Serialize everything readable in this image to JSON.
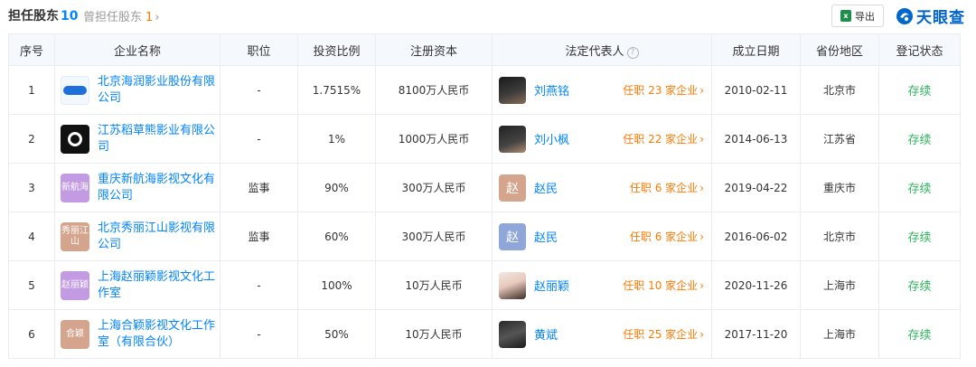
{
  "header": {
    "title": "担任股东",
    "title_count": "10",
    "sub_title": "曾担任股东",
    "sub_count": "1",
    "sub_chevron": "›",
    "export_label": "导出",
    "brand": "天眼查"
  },
  "colors": {
    "link": "#0084ff",
    "tenure": "#ff7a00",
    "status": "#2db55d",
    "header_bg": "#f5f8fc"
  },
  "table": {
    "columns": [
      "序号",
      "企业名称",
      "职位",
      "投资比例",
      "注册资本",
      "法定代表人",
      "成立日期",
      "省份地区",
      "登记状态"
    ],
    "rows": [
      {
        "no": "1",
        "company": "北京海润影业股份有限公司",
        "logo_text": "",
        "logo_bg": "#f3f8ff",
        "position": "-",
        "ratio": "1.7515%",
        "capital": "8100万人民币",
        "rep_name": "刘燕铭",
        "rep_avatar_text": "",
        "rep_avatar_bg": "",
        "tenure": "任职 23 家企业",
        "date": "2010-02-11",
        "region": "北京市",
        "status": "存续"
      },
      {
        "no": "2",
        "company": "江苏稻草熊影业有限公司",
        "logo_text": "",
        "logo_bg": "#111111",
        "position": "-",
        "ratio": "1%",
        "capital": "1000万人民币",
        "rep_name": "刘小枫",
        "rep_avatar_text": "",
        "rep_avatar_bg": "",
        "tenure": "任职 22 家企业",
        "date": "2014-06-13",
        "region": "江苏省",
        "status": "存续"
      },
      {
        "no": "3",
        "company": "重庆新航海影视文化有限公司",
        "logo_text": "新航海",
        "logo_bg": "#c39be3",
        "position": "监事",
        "ratio": "90%",
        "capital": "300万人民币",
        "rep_name": "赵民",
        "rep_avatar_text": "赵",
        "rep_avatar_bg": "#d4a58c",
        "tenure": "任职 6 家企业",
        "date": "2019-04-22",
        "region": "重庆市",
        "status": "存续"
      },
      {
        "no": "4",
        "company": "北京秀丽江山影视有限公司",
        "logo_text": "秀丽江山",
        "logo_bg": "#d4a58c",
        "position": "监事",
        "ratio": "60%",
        "capital": "300万人民币",
        "rep_name": "赵民",
        "rep_avatar_text": "赵",
        "rep_avatar_bg": "#8fa6d9",
        "tenure": "任职 6 家企业",
        "date": "2016-06-02",
        "region": "北京市",
        "status": "存续"
      },
      {
        "no": "5",
        "company": "上海赵丽颖影视文化工作室",
        "logo_text": "赵丽颖",
        "logo_bg": "#c39be3",
        "position": "-",
        "ratio": "100%",
        "capital": "10万人民币",
        "rep_name": "赵丽颖",
        "rep_avatar_text": "",
        "rep_avatar_bg": "",
        "tenure": "任职 10 家企业",
        "date": "2020-11-26",
        "region": "上海市",
        "status": "存续"
      },
      {
        "no": "6",
        "company": "上海合颖影视文化工作室（有限合伙）",
        "logo_text": "合颖",
        "logo_bg": "#d4a58c",
        "position": "-",
        "ratio": "50%",
        "capital": "10万人民币",
        "rep_name": "黄斌",
        "rep_avatar_text": "",
        "rep_avatar_bg": "",
        "tenure": "任职 25 家企业",
        "date": "2017-11-20",
        "region": "上海市",
        "status": "存续"
      }
    ]
  }
}
